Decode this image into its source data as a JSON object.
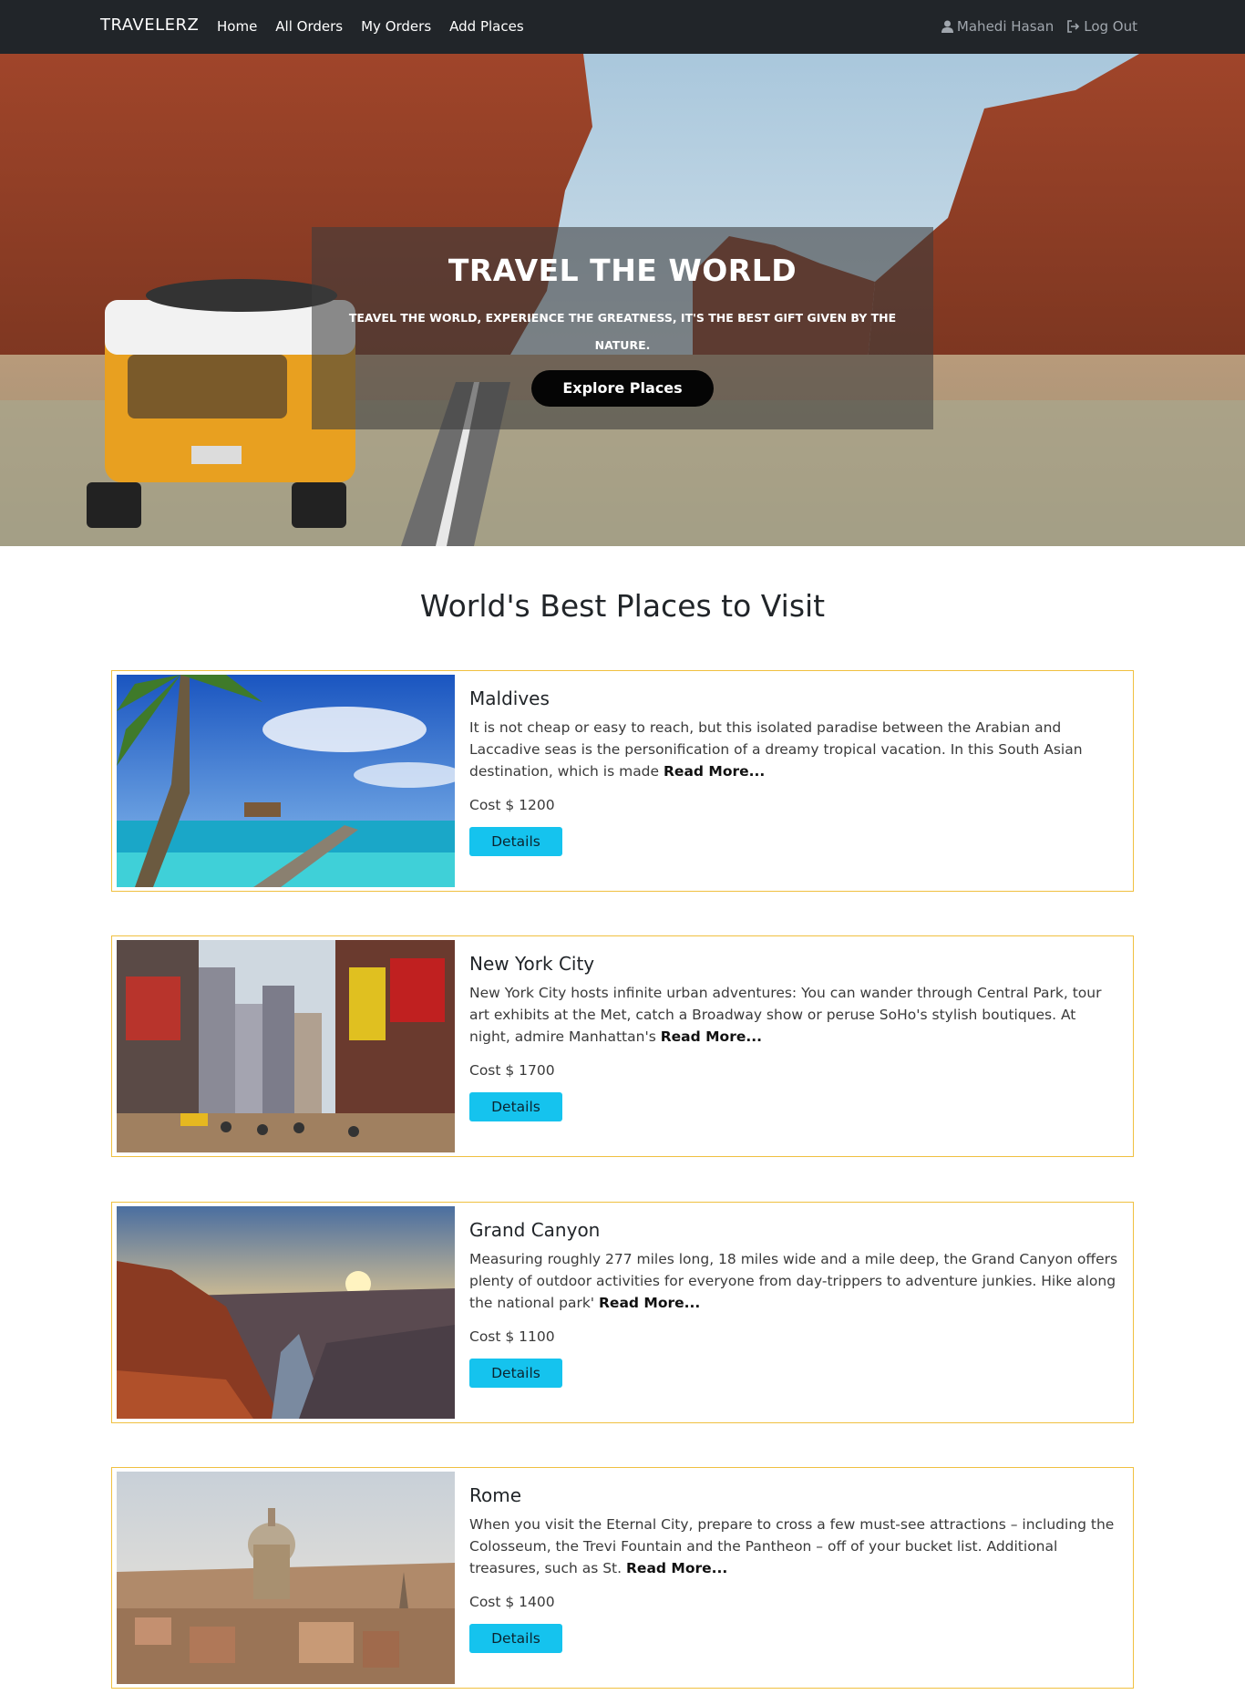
{
  "nav": {
    "brand": "TRAVELERZ",
    "links": [
      "Home",
      "All Orders",
      "My Orders",
      "Add Places"
    ],
    "user_name": "Mahedi Hasan",
    "logout_label": "Log Out"
  },
  "hero": {
    "title": "TRAVEL THE WORLD",
    "subtitle": "TEAVEL THE WORLD, EXPERIENCE THE GREATNESS, IT'S THE BEST GIFT GIVEN BY THE NATURE.",
    "button_label": "Explore Places"
  },
  "section": {
    "title": "World's Best Places to Visit"
  },
  "places": [
    {
      "name": "Maldives",
      "description": "It is not cheap or easy to reach, but this isolated paradise between the Arabian and Laccadive seas is the personification of a dreamy tropical vacation. In this South Asian destination, which is made",
      "read_more": "Read More...",
      "cost": "Cost $ 1200",
      "button": "Details"
    },
    {
      "name": "New York City",
      "description": "New York City hosts infinite urban adventures: You can wander through Central Park, tour art exhibits at the Met, catch a Broadway show or peruse SoHo's stylish boutiques. At night, admire Manhattan's",
      "read_more": "Read More...",
      "cost": "Cost $ 1700",
      "button": "Details"
    },
    {
      "name": "Grand Canyon",
      "description": "Measuring roughly 277 miles long, 18 miles wide and a mile deep, the Grand Canyon offers plenty of outdoor activities for everyone from day-trippers to adventure junkies. Hike along the national park'",
      "read_more": "Read More...",
      "cost": "Cost $ 1100",
      "button": "Details"
    },
    {
      "name": "Rome",
      "description": "When you visit the Eternal City, prepare to cross a few must-see attractions – including the Colosseum, the Trevi Fountain and the Pantheon – off of your bucket list. Additional treasures, such as St.",
      "read_more": "Read More...",
      "cost": "Cost $ 1400",
      "button": "Details"
    }
  ],
  "colors": {
    "navbar": "#212529",
    "card_border": "#f0c040",
    "details_button": "#15c3ee"
  },
  "icons": {
    "user": "user-icon",
    "logout": "logout-icon"
  }
}
